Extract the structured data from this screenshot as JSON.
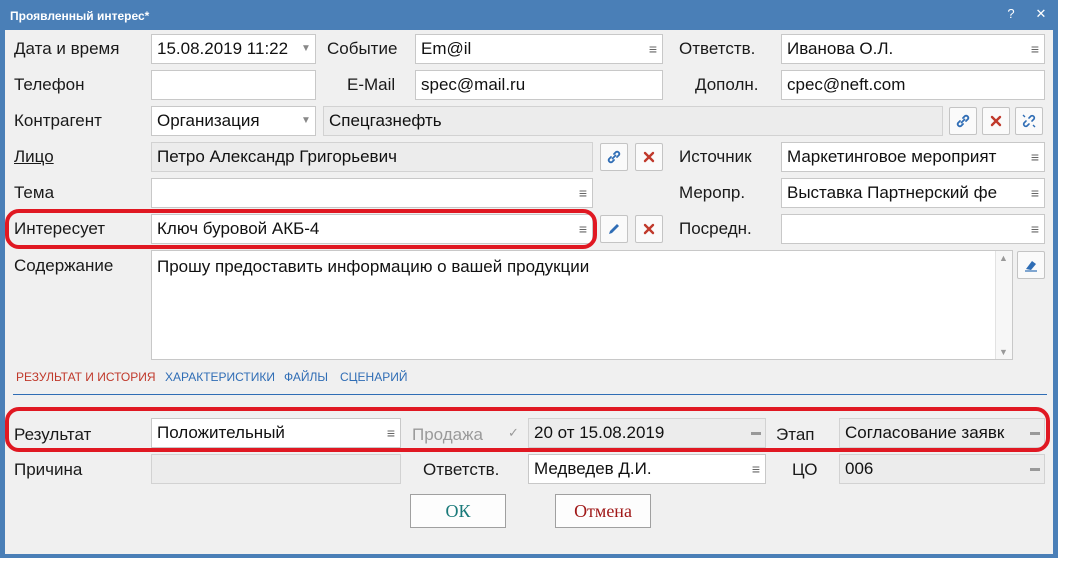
{
  "window": {
    "title": "Проявленный интерес*",
    "help": "?",
    "close": "✕"
  },
  "form": {
    "datetime": {
      "label": "Дата и время",
      "value": "15.08.2019 11:22"
    },
    "event": {
      "label": "Событие",
      "value": "Em@il"
    },
    "responsible": {
      "label": "Ответств.",
      "value": "Иванова О.Л."
    },
    "phone": {
      "label": "Телефон",
      "value": ""
    },
    "email": {
      "label": "E-Mail",
      "value": "spec@mail.ru"
    },
    "additional": {
      "label": "Дополн.",
      "value": "cpec@neft.com"
    },
    "counterparty": {
      "label": "Контрагент",
      "type": "Организация",
      "value": "Спецгазнефть"
    },
    "person": {
      "label": "Лицо",
      "value": "Петро Александр Григорьевич"
    },
    "source": {
      "label": "Источник",
      "value": "Маркетинговое мероприят"
    },
    "topic": {
      "label": "Тема",
      "value": ""
    },
    "activity": {
      "label": "Меропр.",
      "value": "Выставка Партнерский фе"
    },
    "interest": {
      "label": "Интересует",
      "value": "Ключ буровой АКБ-4"
    },
    "intermediary": {
      "label": "Посредн.",
      "value": ""
    },
    "content": {
      "label": "Содержание",
      "value": "Прошу предоставить информацию о вашей продукции"
    }
  },
  "tabs": [
    {
      "label": "РЕЗУЛЬТАТ И ИСТОРИЯ"
    },
    {
      "label": "ХАРАКТЕРИСТИКИ"
    },
    {
      "label": "ФАЙЛЫ"
    },
    {
      "label": "СЦЕНАРИЙ"
    }
  ],
  "result": {
    "result": {
      "label": "Результат",
      "value": "Положительный"
    },
    "sale": {
      "label": "Продажа",
      "check": "✓",
      "value": "20 от 15.08.2019"
    },
    "stage": {
      "label": "Этап",
      "value": "Согласование заявк"
    },
    "reason": {
      "label": "Причина",
      "value": ""
    },
    "responsible": {
      "label": "Ответств.",
      "value": "Медведев Д.И."
    },
    "co": {
      "label": "ЦО",
      "value": "006"
    }
  },
  "buttons": {
    "ok": "ОК",
    "cancel": "Отмена"
  },
  "colors": {
    "highlight": "#e01822",
    "titlebar": "#4a7fb7",
    "tab_active": "#c0392b",
    "tab": "#2f6db5",
    "ok_text": "#1a7a7a",
    "cancel_text": "#a01818"
  }
}
